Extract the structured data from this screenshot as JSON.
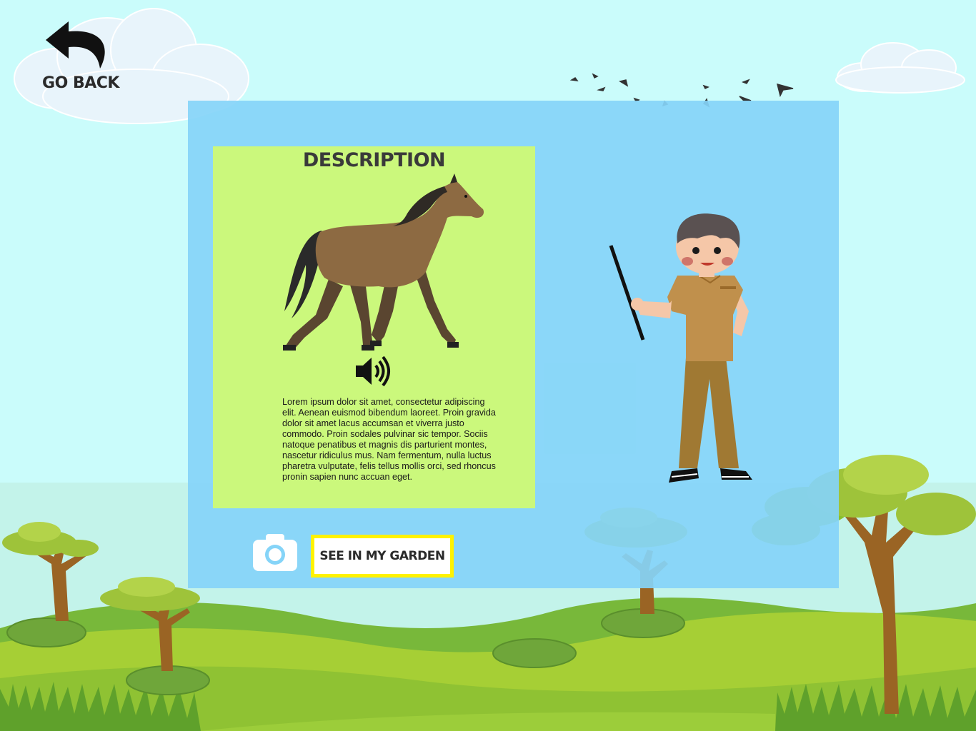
{
  "nav": {
    "go_back_label": "GO BACK"
  },
  "description": {
    "title": "DESCRIPTION",
    "image": "horse-illustration",
    "sound_icon": "speaker-volume-icon",
    "text": "Lorem ipsum dolor sit amet, consectetur adipiscing elit. Aenean euismod bibendum laoreet. Proin gravida dolor sit amet lacus accumsan et viverra justo commodo. Proin sodales pulvinar sic tempor. Sociis natoque penatibus et magnis dis parturient montes, nascetur ridiculus mus. Nam fermentum, nulla luctus pharetra vulputate, felis tellus mollis orci, sed rhoncus pronin sapien nunc accuan eget."
  },
  "actions": {
    "camera_icon": "camera-icon",
    "garden_button_label": "SEE IN MY GARDEN"
  },
  "colors": {
    "sky": "#cafcfb",
    "panel": "#85d4f8",
    "card": "#cbf87c",
    "button_border": "#fff200"
  }
}
